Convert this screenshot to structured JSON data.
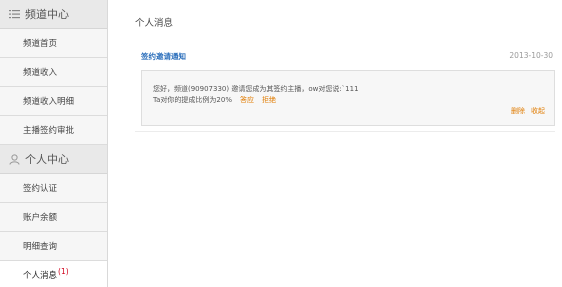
{
  "sidebar": {
    "channel_center": {
      "title": "频道中心",
      "icon": "list-icon",
      "items": [
        {
          "label": "频道首页"
        },
        {
          "label": "频道收入"
        },
        {
          "label": "频道收入明细"
        },
        {
          "label": "主播签约审批"
        }
      ]
    },
    "personal_center": {
      "title": "个人中心",
      "icon": "person-icon",
      "items": [
        {
          "label": "签约认证"
        },
        {
          "label": "账户余额"
        },
        {
          "label": "明细查询"
        },
        {
          "label": "个人消息",
          "badge": "(1)",
          "active": true
        }
      ]
    }
  },
  "main": {
    "title": "个人消息",
    "message": {
      "type": "签约邀请通知",
      "date": "2013-10-30",
      "line1": "您好，频道(90907330) 邀请您成为其签约主播，ow对您说:`111",
      "line2": "Ta对你的提成比例为20%",
      "accept": "答应",
      "reject": "拒绝",
      "delete": "删除",
      "collapse": "收起"
    }
  },
  "colors": {
    "accent": "#2a6ebb",
    "link": "#e07b00",
    "badge": "#d0021b"
  }
}
